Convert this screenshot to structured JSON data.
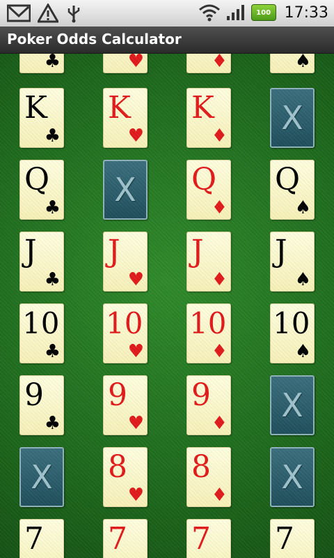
{
  "status_bar": {
    "icons": [
      "gmail-icon",
      "warning-icon",
      "usb-icon",
      "wifi-icon",
      "signal-icon",
      "battery-icon"
    ],
    "battery_level": "100",
    "time": "17:33"
  },
  "app": {
    "title": "Poker Odds Calculator"
  },
  "colors": {
    "felt": "#1f6d1e",
    "red_suit": "#e11b1b",
    "card_back": "#1f4f5c"
  },
  "grid": {
    "rows": [
      {
        "cards": [
          {
            "rank": "",
            "suit": "♣",
            "color": "black"
          },
          {
            "rank": "",
            "suit": "♥",
            "color": "red"
          },
          {
            "rank": "",
            "suit": "♦",
            "color": "red"
          },
          {
            "rank": "",
            "suit": "♠",
            "color": "black"
          }
        ]
      },
      {
        "cards": [
          {
            "rank": "K",
            "suit": "♣",
            "color": "black"
          },
          {
            "rank": "K",
            "suit": "♥",
            "color": "red"
          },
          {
            "rank": "K",
            "suit": "♦",
            "color": "red"
          },
          {
            "back": true,
            "label": "X"
          }
        ]
      },
      {
        "cards": [
          {
            "rank": "Q",
            "suit": "♣",
            "color": "black"
          },
          {
            "back": true,
            "label": "X"
          },
          {
            "rank": "Q",
            "suit": "♦",
            "color": "red"
          },
          {
            "rank": "Q",
            "suit": "♠",
            "color": "black"
          }
        ]
      },
      {
        "cards": [
          {
            "rank": "J",
            "suit": "♣",
            "color": "black"
          },
          {
            "rank": "J",
            "suit": "♥",
            "color": "red"
          },
          {
            "rank": "J",
            "suit": "♦",
            "color": "red"
          },
          {
            "rank": "J",
            "suit": "♠",
            "color": "black"
          }
        ]
      },
      {
        "cards": [
          {
            "rank": "10",
            "suit": "♣",
            "color": "black"
          },
          {
            "rank": "10",
            "suit": "♥",
            "color": "red"
          },
          {
            "rank": "10",
            "suit": "♦",
            "color": "red"
          },
          {
            "rank": "10",
            "suit": "♠",
            "color": "black"
          }
        ]
      },
      {
        "cards": [
          {
            "rank": "9",
            "suit": "♣",
            "color": "black"
          },
          {
            "rank": "9",
            "suit": "♥",
            "color": "red"
          },
          {
            "rank": "9",
            "suit": "♦",
            "color": "red"
          },
          {
            "back": true,
            "label": "X"
          }
        ]
      },
      {
        "cards": [
          {
            "back": true,
            "label": "X"
          },
          {
            "rank": "8",
            "suit": "♥",
            "color": "red"
          },
          {
            "rank": "8",
            "suit": "♦",
            "color": "red"
          },
          {
            "back": true,
            "label": "X"
          }
        ]
      },
      {
        "cards": [
          {
            "rank": "7",
            "suit": "",
            "color": "black"
          },
          {
            "rank": "7",
            "suit": "",
            "color": "red"
          },
          {
            "rank": "7",
            "suit": "",
            "color": "red"
          },
          {
            "rank": "7",
            "suit": "",
            "color": "black"
          }
        ]
      }
    ]
  }
}
